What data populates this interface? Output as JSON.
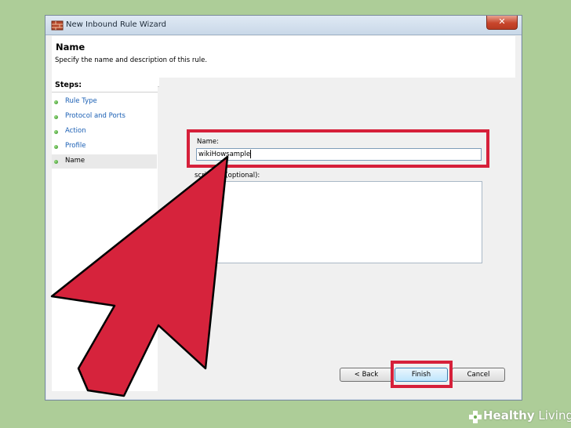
{
  "window": {
    "title": "New Inbound Rule Wizard",
    "close_glyph": "✕"
  },
  "header": {
    "title": "Name",
    "description": "Specify the name and description of this rule."
  },
  "steps": {
    "title": "Steps:",
    "items": [
      {
        "label": "Rule Type",
        "state": "done"
      },
      {
        "label": "Protocol and Ports",
        "state": "done"
      },
      {
        "label": "Action",
        "state": "done"
      },
      {
        "label": "Profile",
        "state": "done"
      },
      {
        "label": "Name",
        "state": "current"
      }
    ]
  },
  "form": {
    "name_label": "Name:",
    "name_value": "wikiHowsample",
    "description_label": "Description (optional):",
    "description_visible_label": "scription (optional):",
    "description_value": ""
  },
  "buttons": {
    "back": "< Back",
    "finish": "Finish",
    "cancel": "Cancel"
  },
  "overlay": {
    "highlight_color": "#d6203a",
    "arrow_color": "#d6233c"
  },
  "brand": {
    "part1": "Healthy",
    "part2": " Living"
  },
  "colors": {
    "background": "#adcd98",
    "link": "#1a5fb4"
  }
}
